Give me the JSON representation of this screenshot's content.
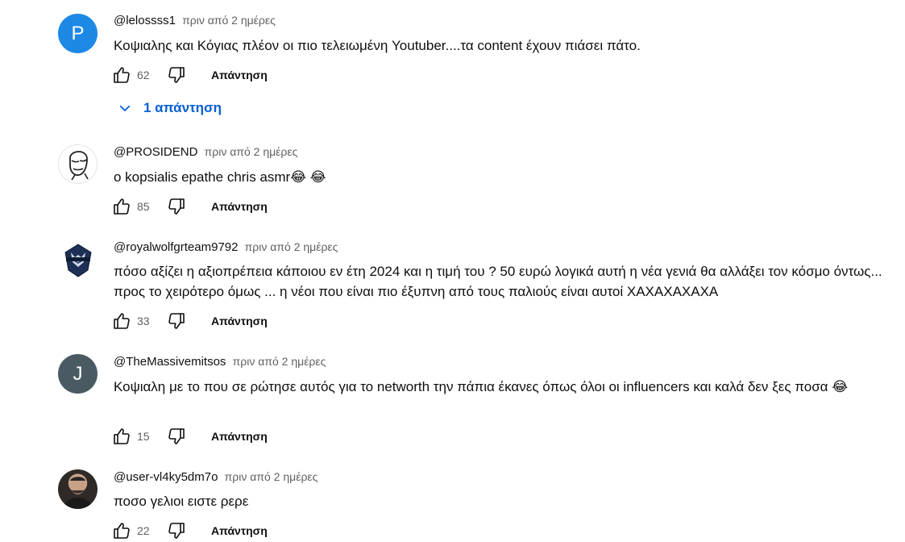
{
  "comments": [
    {
      "handle": "@lelossss1",
      "time": "πριν από 2 ημέρες",
      "avatar_letter": "P",
      "text": "Κοψιαλης και Κόγιας  πλέον οι πιο τελειωμένη Youtuber....τα content έχουν πιάσει πάτο.",
      "likes": "62",
      "reply_label": "Απάντηση",
      "replies_label": "1 απάντηση"
    },
    {
      "handle": "@PROSIDEND",
      "time": "πριν από 2 ημέρες",
      "text": "ο kopsialis epathe chris asmr😂 😂",
      "likes": "85",
      "reply_label": "Απάντηση"
    },
    {
      "handle": "@royalwolfgrteam9792",
      "time": "πριν από 2 ημέρες",
      "text": "πόσο αξίζει η αξιοπρέπεια κάποιου εν έτη 2024 και η τιμή του  ? 50 ευρώ λογικά αυτή η νέα γενιά θα αλλάξει τον κόσμο όντως... προς το χειρότερο όμως ... η νέοι που είναι πιο έξυπνη από τους παλιούς είναι αυτοί ΧΑΧΑΧΑΧΑΧΑ",
      "likes": "33",
      "reply_label": "Απάντηση"
    },
    {
      "handle": "@TheMassivemitsos",
      "time": "πριν από 2 ημέρες",
      "avatar_letter": "J",
      "text": "Κοψιαλη με το που σε ρώτησε αυτός για το networth την πάπια έκανες όπως όλοι οι influencers και καλά δεν ξες ποσα 😂",
      "likes": "15",
      "reply_label": "Απάντηση"
    },
    {
      "handle": "@user-vl4ky5dm7o",
      "time": "πριν από 2 ημέρες",
      "text": "ποσο γελιοι ειστε ρερε",
      "likes": "22",
      "reply_label": "Απάντηση"
    }
  ],
  "icons": {
    "like": "thumbs-up-icon",
    "dislike": "thumbs-down-icon",
    "expand": "chevron-down-icon"
  },
  "colors": {
    "link_blue": "#065fd4",
    "avatar_p": "#1e88e5",
    "avatar_j": "#4a5a63",
    "secondary_text": "#606060"
  }
}
